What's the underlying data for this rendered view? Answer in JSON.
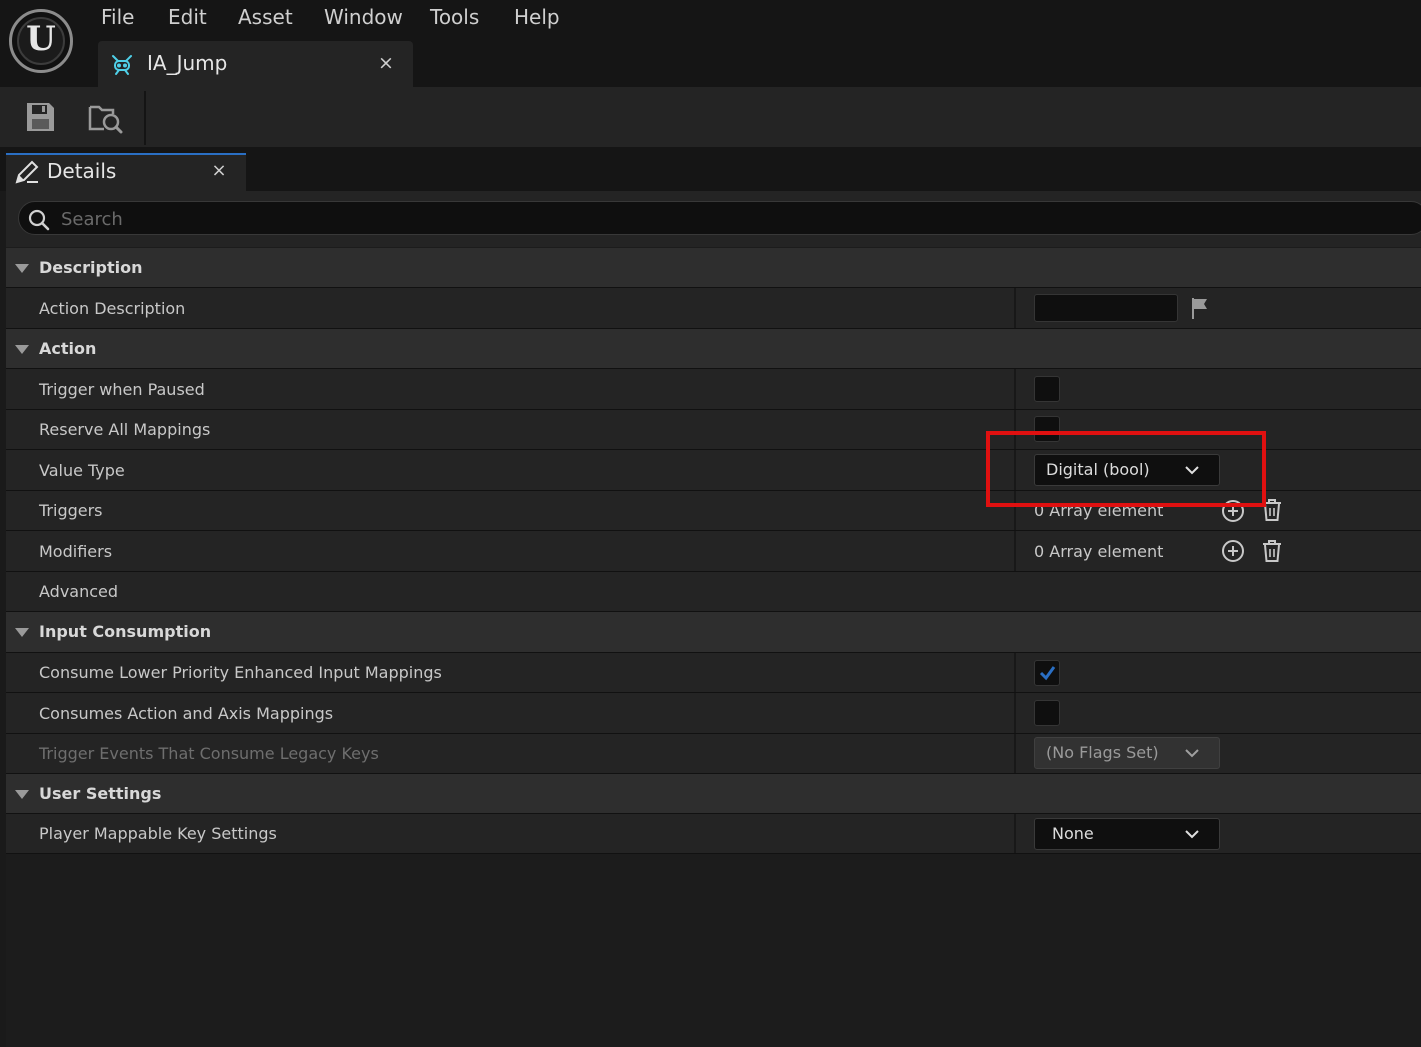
{
  "app": {
    "logo_letter": "U"
  },
  "menu": [
    "File",
    "Edit",
    "Asset",
    "Window",
    "Tools",
    "Help"
  ],
  "document_tab": {
    "label": "IA_Jump",
    "close": "×"
  },
  "toolbar": {
    "save_icon": "save-icon",
    "browse_icon": "browse-to-asset-icon"
  },
  "details_tab": {
    "label": "Details",
    "close": "×"
  },
  "search": {
    "placeholder": "Search",
    "value": ""
  },
  "sections": {
    "description": {
      "label": "Description",
      "action_description": {
        "label": "Action Description",
        "value": ""
      }
    },
    "action": {
      "label": "Action",
      "trigger_when_paused": {
        "label": "Trigger when Paused",
        "checked": false
      },
      "reserve_all_mappings": {
        "label": "Reserve All Mappings",
        "checked": false
      },
      "value_type": {
        "label": "Value Type",
        "value": "Digital (bool)"
      },
      "triggers": {
        "label": "Triggers",
        "value": "0 Array element"
      },
      "modifiers": {
        "label": "Modifiers",
        "value": "0 Array element"
      }
    },
    "advanced": {
      "label": "Advanced",
      "expanded": false
    },
    "input_consumption": {
      "label": "Input Consumption",
      "consume_lower_priority": {
        "label": "Consume Lower Priority Enhanced Input Mappings",
        "checked": true
      },
      "consumes_action_axis": {
        "label": "Consumes Action and Axis Mappings",
        "checked": false
      },
      "trigger_events_legacy": {
        "label": "Trigger Events That Consume Legacy Keys",
        "value": "(No Flags Set)",
        "enabled": false
      }
    },
    "user_settings": {
      "label": "User Settings",
      "player_mappable": {
        "label": "Player Mappable Key Settings",
        "value": "None"
      }
    }
  },
  "colors": {
    "accent": "#2a6fc4",
    "highlight": "#e01010",
    "background": "#1a1a1a"
  }
}
